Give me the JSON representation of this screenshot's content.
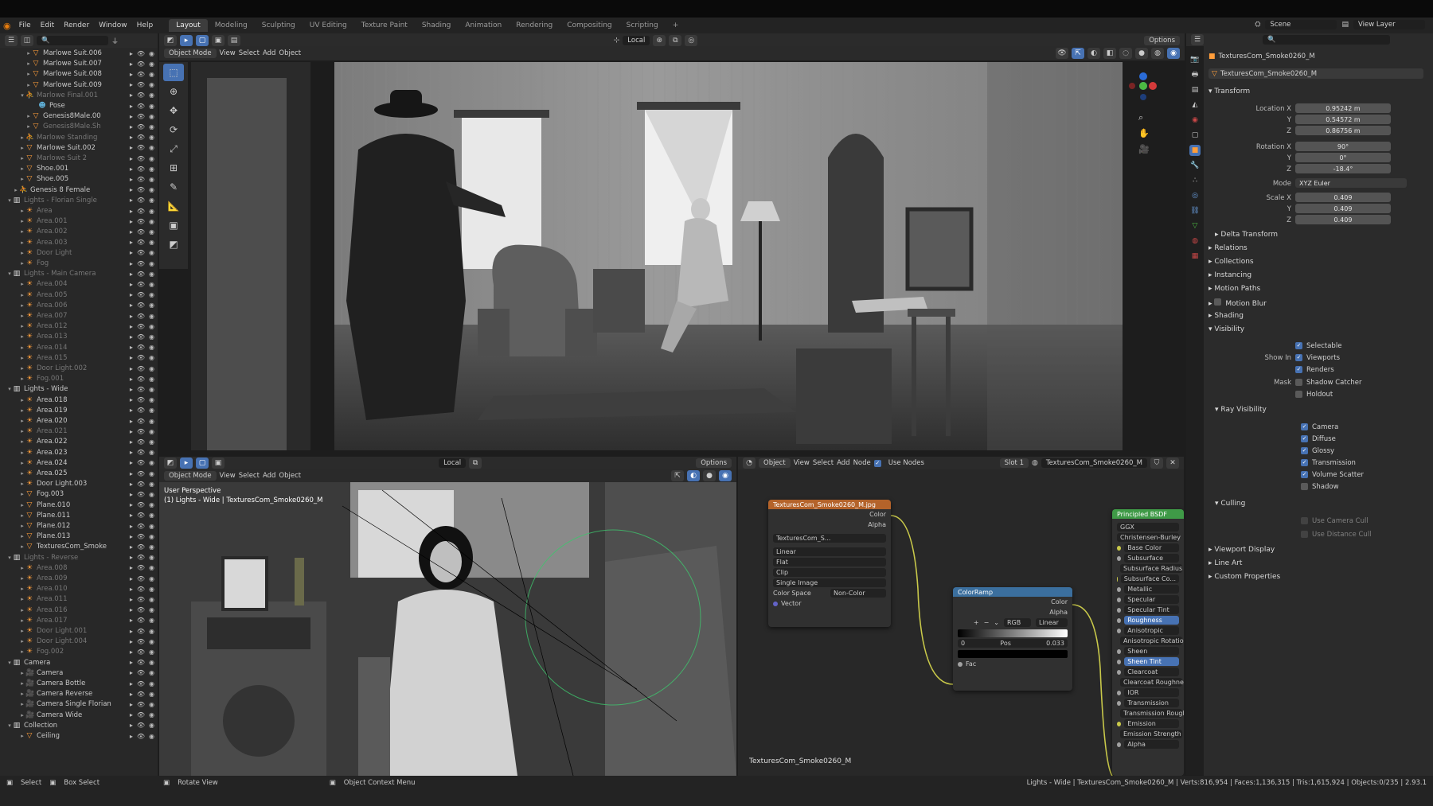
{
  "menu": [
    "File",
    "Edit",
    "Render",
    "Window",
    "Help"
  ],
  "workspaces": [
    "Layout",
    "Modeling",
    "Sculpting",
    "UV Editing",
    "Texture Paint",
    "Shading",
    "Animation",
    "Rendering",
    "Compositing",
    "Scripting"
  ],
  "topright": {
    "scene": "Scene",
    "view_layer": "View Layer"
  },
  "viewport_header": {
    "mode": "Object Mode",
    "view": "View",
    "select": "Select",
    "add": "Add",
    "object": "Object",
    "orientation": "Local",
    "options": "Options"
  },
  "viewport2": {
    "mode": "Object Mode",
    "view": "View",
    "select": "Select",
    "add": "Add",
    "object": "Object",
    "orientation": "Local",
    "options": "Options",
    "overlay_title": "User Perspective",
    "overlay_sub": "(1) Lights - Wide | TexturesCom_Smoke0260_M"
  },
  "outliner": [
    {
      "label": "Marlowe Suit.006",
      "indent": 4,
      "icon": "tri",
      "dim": false,
      "exp": "▸"
    },
    {
      "label": "Marlowe Suit.007",
      "indent": 4,
      "icon": "tri",
      "dim": false,
      "exp": "▸"
    },
    {
      "label": "Marlowe Suit.008",
      "indent": 4,
      "icon": "tri",
      "dim": false,
      "exp": "▸"
    },
    {
      "label": "Marlowe Suit.009",
      "indent": 4,
      "icon": "tri",
      "dim": false,
      "exp": "▸"
    },
    {
      "label": "Marlowe Final.001",
      "indent": 3,
      "icon": "arm",
      "dim": true,
      "exp": "▾"
    },
    {
      "label": "Pose",
      "indent": 5,
      "icon": "pose",
      "dim": false,
      "exp": ""
    },
    {
      "label": "Genesis8Male.00",
      "indent": 4,
      "icon": "tri",
      "dim": false,
      "exp": "▸"
    },
    {
      "label": "Genesis8Male.Sh",
      "indent": 4,
      "icon": "tri",
      "dim": true,
      "exp": "▸"
    },
    {
      "label": "Marlowe Standing",
      "indent": 3,
      "icon": "arm",
      "dim": true,
      "exp": "▸"
    },
    {
      "label": "Marlowe Suit.002",
      "indent": 3,
      "icon": "tri",
      "dim": false,
      "exp": "▸"
    },
    {
      "label": "Marlowe Suit 2",
      "indent": 3,
      "icon": "tri",
      "dim": true,
      "exp": "▸"
    },
    {
      "label": "Shoe.001",
      "indent": 3,
      "icon": "tri",
      "dim": false,
      "exp": "▸"
    },
    {
      "label": "Shoe.005",
      "indent": 3,
      "icon": "tri",
      "dim": false,
      "exp": "▸"
    },
    {
      "label": "Genesis 8 Female",
      "indent": 2,
      "icon": "arm",
      "dim": false,
      "exp": "▸"
    },
    {
      "label": "Lights - Florian Single",
      "indent": 1,
      "icon": "coll",
      "dim": true,
      "exp": "▾"
    },
    {
      "label": "Area",
      "indent": 3,
      "icon": "light",
      "dim": true,
      "exp": "▸"
    },
    {
      "label": "Area.001",
      "indent": 3,
      "icon": "light",
      "dim": true,
      "exp": "▸"
    },
    {
      "label": "Area.002",
      "indent": 3,
      "icon": "light",
      "dim": true,
      "exp": "▸"
    },
    {
      "label": "Area.003",
      "indent": 3,
      "icon": "light",
      "dim": true,
      "exp": "▸"
    },
    {
      "label": "Door Light",
      "indent": 3,
      "icon": "light",
      "dim": true,
      "exp": "▸"
    },
    {
      "label": "Fog",
      "indent": 3,
      "icon": "light",
      "dim": true,
      "exp": "▸"
    },
    {
      "label": "Lights - Main Camera",
      "indent": 1,
      "icon": "coll",
      "dim": true,
      "exp": "▾"
    },
    {
      "label": "Area.004",
      "indent": 3,
      "icon": "light",
      "dim": true,
      "exp": "▸"
    },
    {
      "label": "Area.005",
      "indent": 3,
      "icon": "light",
      "dim": true,
      "exp": "▸"
    },
    {
      "label": "Area.006",
      "indent": 3,
      "icon": "light",
      "dim": true,
      "exp": "▸"
    },
    {
      "label": "Area.007",
      "indent": 3,
      "icon": "light",
      "dim": true,
      "exp": "▸"
    },
    {
      "label": "Area.012",
      "indent": 3,
      "icon": "light",
      "dim": true,
      "exp": "▸"
    },
    {
      "label": "Area.013",
      "indent": 3,
      "icon": "light",
      "dim": true,
      "exp": "▸"
    },
    {
      "label": "Area.014",
      "indent": 3,
      "icon": "light",
      "dim": true,
      "exp": "▸"
    },
    {
      "label": "Area.015",
      "indent": 3,
      "icon": "light",
      "dim": true,
      "exp": "▸"
    },
    {
      "label": "Door Light.002",
      "indent": 3,
      "icon": "light",
      "dim": true,
      "exp": "▸"
    },
    {
      "label": "Fog.001",
      "indent": 3,
      "icon": "light",
      "dim": true,
      "exp": "▸"
    },
    {
      "label": "Lights - Wide",
      "indent": 1,
      "icon": "coll",
      "dim": false,
      "exp": "▾"
    },
    {
      "label": "Area.018",
      "indent": 3,
      "icon": "light",
      "dim": false,
      "exp": "▸"
    },
    {
      "label": "Area.019",
      "indent": 3,
      "icon": "light",
      "dim": false,
      "exp": "▸"
    },
    {
      "label": "Area.020",
      "indent": 3,
      "icon": "light",
      "dim": false,
      "exp": "▸"
    },
    {
      "label": "Area.021",
      "indent": 3,
      "icon": "light",
      "dim": true,
      "exp": "▸"
    },
    {
      "label": "Area.022",
      "indent": 3,
      "icon": "light",
      "dim": false,
      "exp": "▸"
    },
    {
      "label": "Area.023",
      "indent": 3,
      "icon": "light",
      "dim": false,
      "exp": "▸"
    },
    {
      "label": "Area.024",
      "indent": 3,
      "icon": "light",
      "dim": false,
      "exp": "▸"
    },
    {
      "label": "Area.025",
      "indent": 3,
      "icon": "light",
      "dim": false,
      "exp": "▸"
    },
    {
      "label": "Door Light.003",
      "indent": 3,
      "icon": "light",
      "dim": false,
      "exp": "▸"
    },
    {
      "label": "Fog.003",
      "indent": 3,
      "icon": "tri",
      "dim": false,
      "exp": "▸"
    },
    {
      "label": "Plane.010",
      "indent": 3,
      "icon": "tri",
      "dim": false,
      "exp": "▸"
    },
    {
      "label": "Plane.011",
      "indent": 3,
      "icon": "tri",
      "dim": false,
      "exp": "▸"
    },
    {
      "label": "Plane.012",
      "indent": 3,
      "icon": "tri",
      "dim": false,
      "exp": "▸"
    },
    {
      "label": "Plane.013",
      "indent": 3,
      "icon": "tri",
      "dim": false,
      "exp": "▸"
    },
    {
      "label": "TexturesCom_Smoke",
      "indent": 3,
      "icon": "tri",
      "dim": false,
      "exp": "▸"
    },
    {
      "label": "Lights - Reverse",
      "indent": 1,
      "icon": "coll",
      "dim": true,
      "exp": "▾"
    },
    {
      "label": "Area.008",
      "indent": 3,
      "icon": "light",
      "dim": true,
      "exp": "▸"
    },
    {
      "label": "Area.009",
      "indent": 3,
      "icon": "light",
      "dim": true,
      "exp": "▸"
    },
    {
      "label": "Area.010",
      "indent": 3,
      "icon": "light",
      "dim": true,
      "exp": "▸"
    },
    {
      "label": "Area.011",
      "indent": 3,
      "icon": "light",
      "dim": true,
      "exp": "▸"
    },
    {
      "label": "Area.016",
      "indent": 3,
      "icon": "light",
      "dim": true,
      "exp": "▸"
    },
    {
      "label": "Area.017",
      "indent": 3,
      "icon": "light",
      "dim": true,
      "exp": "▸"
    },
    {
      "label": "Door Light.001",
      "indent": 3,
      "icon": "light",
      "dim": true,
      "exp": "▸"
    },
    {
      "label": "Door Light.004",
      "indent": 3,
      "icon": "light",
      "dim": true,
      "exp": "▸"
    },
    {
      "label": "Fog.002",
      "indent": 3,
      "icon": "light",
      "dim": true,
      "exp": "▸"
    },
    {
      "label": "Camera",
      "indent": 1,
      "icon": "coll",
      "dim": false,
      "exp": "▾"
    },
    {
      "label": "Camera",
      "indent": 3,
      "icon": "cam",
      "dim": false,
      "exp": "▸"
    },
    {
      "label": "Camera Bottle",
      "indent": 3,
      "icon": "cam",
      "dim": false,
      "exp": "▸"
    },
    {
      "label": "Camera Reverse",
      "indent": 3,
      "icon": "cam",
      "dim": false,
      "exp": "▸"
    },
    {
      "label": "Camera Single Florian",
      "indent": 3,
      "icon": "cam",
      "dim": false,
      "exp": "▸"
    },
    {
      "label": "Camera Wide",
      "indent": 3,
      "icon": "cam",
      "dim": false,
      "exp": "▸"
    },
    {
      "label": "Collection",
      "indent": 1,
      "icon": "coll",
      "dim": false,
      "exp": "▾"
    },
    {
      "label": "Ceiling",
      "indent": 3,
      "icon": "tri",
      "dim": false,
      "exp": "▸"
    }
  ],
  "node_editor": {
    "object": "Object",
    "view": "View",
    "select": "Select",
    "add": "Add",
    "node": "Node",
    "use_nodes": "Use Nodes",
    "slot": "Slot 1",
    "material": "TexturesCom_Smoke0260_M",
    "footer_label": "TexturesCom_Smoke0260_M"
  },
  "image_node": {
    "title": "TexturesCom_Smoke0260_M.jpg",
    "out_color": "Color",
    "out_alpha": "Alpha",
    "image": "TexturesCom_S...",
    "interp": "Linear",
    "proj": "Flat",
    "ext": "Clip",
    "source": "Single Image",
    "cs_label": "Color Space",
    "cs_value": "Non-Color",
    "vector": "Vector"
  },
  "ramp_node": {
    "title": "ColorRamp",
    "out_color": "Color",
    "out_alpha": "Alpha",
    "mode": "RGB",
    "interp": "Linear",
    "index": "0",
    "pos_label": "Pos",
    "pos": "0.033",
    "fac": "Fac"
  },
  "bsdf_node": {
    "title": "Principled BSDF",
    "dist": "GGX",
    "ss": "Christensen-Burley",
    "inputs": [
      "Base Color",
      "Subsurface",
      "Subsurface Radius",
      "Subsurface Co...",
      "Metallic",
      "Specular",
      "Specular Tint",
      "Roughness",
      "Anisotropic",
      "Anisotropic Rotation",
      "Sheen",
      "Sheen Tint",
      "Clearcoat",
      "Clearcoat Roughness",
      "IOR",
      "Transmission",
      "Transmission Roughne...",
      "Emission",
      "Emission Strength",
      "Alpha"
    ]
  },
  "properties": {
    "object_name": "TexturesCom_Smoke0260_M",
    "data_name": "TexturesCom_Smoke0260_M",
    "transform": "Transform",
    "location_label": "Location X",
    "loc": [
      "0.95242 m",
      "0.54572 m",
      "0.86756 m"
    ],
    "rotation_label": "Rotation X",
    "rot": [
      "90°",
      "0°",
      "-18.4°"
    ],
    "mode_label": "Mode",
    "mode": "XYZ Euler",
    "scale_label": "Scale X",
    "scale": [
      "0.409",
      "0.409",
      "0.409"
    ],
    "y": "Y",
    "z": "Z",
    "sections": [
      "Delta Transform",
      "Relations",
      "Collections",
      "Instancing",
      "Motion Paths",
      "Motion Blur",
      "Shading",
      "Visibility"
    ],
    "selectable": "Selectable",
    "show_in": "Show In",
    "viewports": "Viewports",
    "renders": "Renders",
    "mask": "Mask",
    "shadow_catcher": "Shadow Catcher",
    "holdout": "Holdout",
    "ray_visibility": "Ray Visibility",
    "rays": [
      "Camera",
      "Diffuse",
      "Glossy",
      "Transmission",
      "Volume Scatter",
      "Shadow"
    ],
    "culling": "Culling",
    "cam_cull": "Use Camera Cull",
    "dist_cull": "Use Distance Cull",
    "bottom_sections": [
      "Viewport Display",
      "Line Art",
      "Custom Properties"
    ]
  },
  "status": {
    "select": "Select",
    "box_select": "Box Select",
    "rotate": "Rotate View",
    "context": "Object Context Menu",
    "stats": "Lights - Wide | TexturesCom_Smoke0260_M | Verts:816,954 | Faces:1,136,315 | Tris:1,615,924 | Objects:0/235 | 2.93.1"
  },
  "colors": {
    "accent": "#4772b3",
    "image_node": "#b4632a",
    "ramp_node": "#3b6f9e",
    "bsdf_node": "#3f9a47"
  }
}
